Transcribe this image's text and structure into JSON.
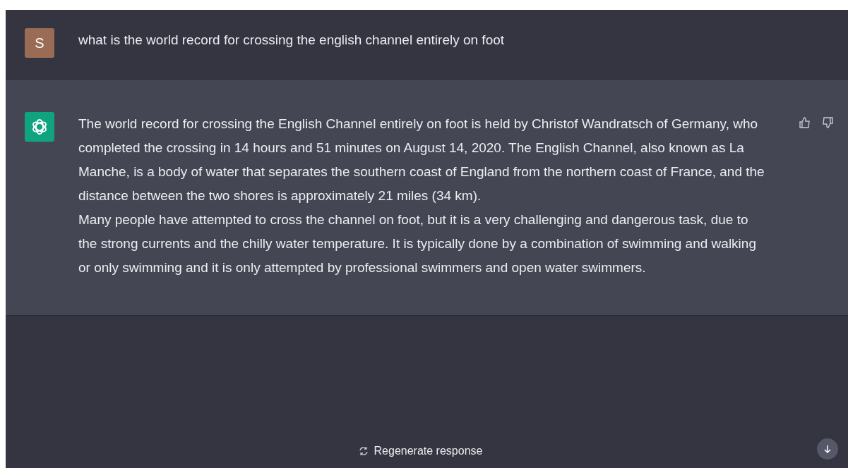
{
  "messages": [
    {
      "kind": "user",
      "avatar": "S",
      "text": [
        "what is the world record for crossing the english channel entirely on foot"
      ]
    },
    {
      "kind": "assistant",
      "text": [
        "The world record for crossing the English Channel entirely on foot is held by Christof Wandratsch of Germany, who completed the crossing in 14 hours and 51 minutes on August 14, 2020. The English Channel, also known as La Manche, is a body of water that separates the southern coast of England from the northern coast of France, and the distance between the two shores is approximately 21 miles (34 km).",
        "Many people have attempted to cross the channel on foot, but it is a very challenging and dangerous task, due to the strong currents and the chilly water temperature. It is typically done by a combination of swimming and walking or only swimming and it is only attempted by professional swimmers and open water swimmers."
      ]
    }
  ],
  "regenerate_button": "Regenerate response"
}
